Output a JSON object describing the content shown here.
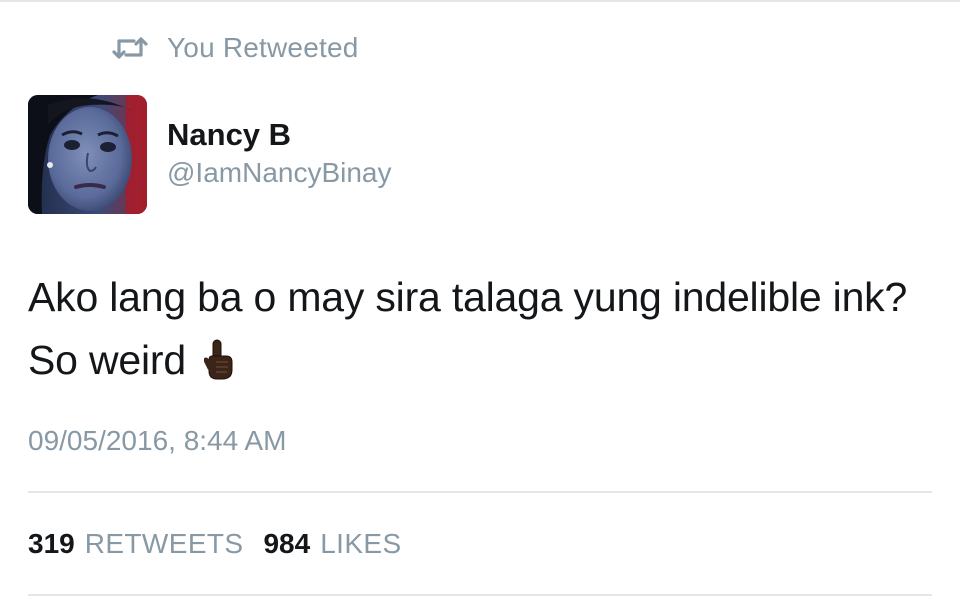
{
  "context": {
    "icon": "retweet-icon",
    "text": "You Retweeted"
  },
  "author": {
    "name": "Nancy B",
    "handle": "@IamNancyBinay",
    "avatar": "profile-photo"
  },
  "tweet": {
    "text": "Ako lang ba o may sira talaga yung indelible ink? So weird",
    "emoji": "pointing-up-finger-dark-skin-tone"
  },
  "timestamp": "09/05/2016, 8:44 AM",
  "stats": {
    "retweets_count": "319",
    "retweets_label": "RETWEETS",
    "likes_count": "984",
    "likes_label": "LIKES"
  },
  "colors": {
    "text_primary": "#14171a",
    "text_secondary": "#8899a6",
    "divider": "#e4e7ea",
    "background": "#ffffff"
  }
}
